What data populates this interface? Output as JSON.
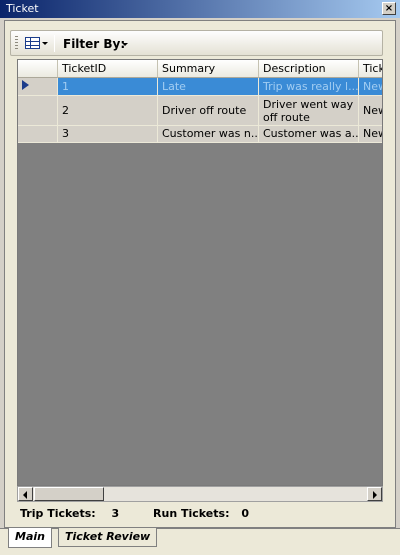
{
  "window": {
    "title": "Ticket",
    "close_glyph": "×"
  },
  "toolbar": {
    "view_icon": "grid-view-icon",
    "filter_label": "Filter By:"
  },
  "grid": {
    "columns": [
      "",
      "TicketID",
      "Summary",
      "Description",
      "Tick"
    ],
    "rows": [
      {
        "id": "1",
        "summary": "Late",
        "description": "Trip was really l...",
        "tick": "New",
        "selected": true
      },
      {
        "id": "2",
        "summary": "Driver off route",
        "description": "Driver went way off route",
        "tick": "New",
        "selected": false
      },
      {
        "id": "3",
        "summary": "Customer was n...",
        "description": "Customer was a...",
        "tick": "New",
        "selected": false
      }
    ]
  },
  "status": {
    "trip_label": "Trip Tickets:",
    "trip_count": "3",
    "run_label": "Run Tickets:",
    "run_count": "0"
  },
  "tabs": [
    {
      "label": "Main",
      "active": true
    },
    {
      "label": "Ticket Review",
      "active": false
    }
  ],
  "colors": {
    "selection": "#3a8bd6",
    "title_bar": "#0a246a",
    "grid_bg": "#808080"
  }
}
